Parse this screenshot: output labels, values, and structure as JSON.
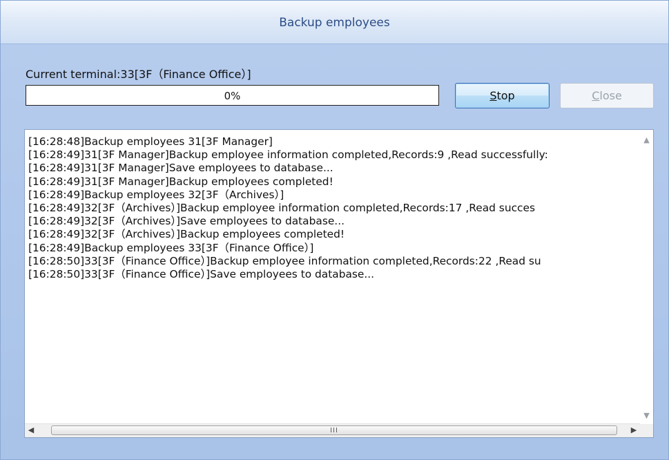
{
  "dialog": {
    "title": "Backup employees",
    "terminal_label": "Current terminal:33[3F（Finance Office）]",
    "progress": {
      "value": 0,
      "text": "0%"
    },
    "buttons": {
      "stop": {
        "label_underlined": "S",
        "label_rest": "top"
      },
      "close": {
        "label_underlined": "C",
        "label_rest": "lose"
      }
    },
    "log": [
      "[16:28:48]Backup employees 31[3F Manager]",
      "[16:28:49]31[3F Manager]Backup employee information completed,Records:9 ,Read successfully:",
      "[16:28:49]31[3F Manager]Save employees to database...",
      "[16:28:49]31[3F Manager]Backup employees completed!",
      "[16:28:49]Backup employees 32[3F（Archives）]",
      "[16:28:49]32[3F（Archives）]Backup employee information completed,Records:17 ,Read succes",
      "[16:28:49]32[3F（Archives）]Save employees to database...",
      "[16:28:49]32[3F（Archives）]Backup employees completed!",
      "[16:28:49]Backup employees 33[3F（Finance Office）]",
      "[16:28:50]33[3F（Finance Office）]Backup employee information completed,Records:22 ,Read su",
      "[16:28:50]33[3F（Finance Office）]Save employees to database..."
    ],
    "scroll": {
      "h_grip": "III"
    }
  }
}
